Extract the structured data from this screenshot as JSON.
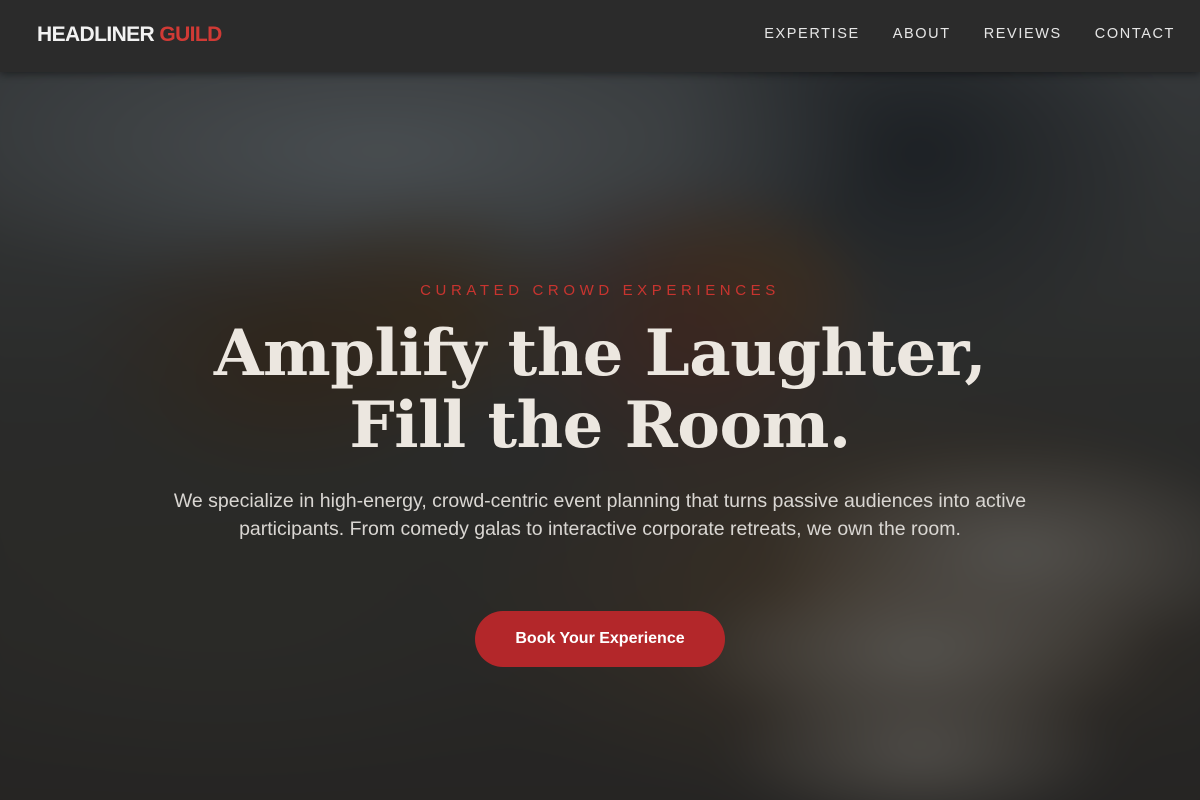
{
  "header": {
    "logo": {
      "primary": "HEADLINER",
      "accent": "GUILD"
    },
    "nav": [
      "EXPERTISE",
      "ABOUT",
      "REVIEWS",
      "CONTACT"
    ]
  },
  "hero": {
    "eyebrow": "CURATED CROWD EXPERIENCES",
    "headline_line1": "Amplify the Laughter,",
    "headline_line2": "Fill the Room.",
    "subtext": "We specialize in high-energy, crowd-centric event planning that turns passive audiences into active participants. From comedy galas to interactive corporate retreats, we own the room.",
    "cta_label": "Book Your Experience"
  },
  "colors": {
    "accent": "#c8342f",
    "button": "#b3272a",
    "header_bg": "#2b2b2b",
    "text_light": "#ece7e0"
  }
}
